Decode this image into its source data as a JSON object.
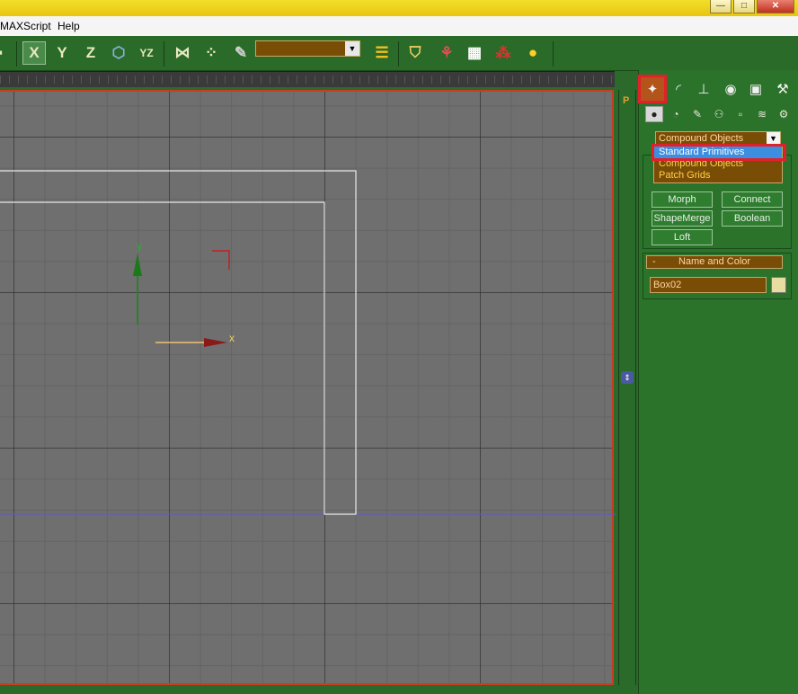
{
  "window": {
    "minimize": "—",
    "maximize": "□",
    "close": "✕"
  },
  "menu": {
    "items": [
      "MAXScript",
      "Help"
    ]
  },
  "toolbar": {
    "axis_x": "X",
    "axis_y": "Y",
    "axis_z": "Z",
    "plane": "YZ",
    "selection_set_value": ""
  },
  "viewport": {
    "axis_y_label": "y",
    "axis_x_label": "x",
    "grid_color": "#6f6f6f",
    "border_color": "#c83d22"
  },
  "sidebar_strip": {
    "label": "P"
  },
  "command_panel": {
    "category_value": "Compound Objects",
    "category_options": [
      "Standard Primitives",
      "Compound Objects",
      "Patch Grids"
    ],
    "highlighted_option": "Standard Primitives",
    "object_buttons": [
      "Morph",
      "Connect",
      "ShapeMerge",
      "Boolean",
      "Loft"
    ],
    "name_and_color": {
      "header": "Name and Color",
      "collapse_symbol": "-",
      "name_value": "Box02",
      "swatch_color": "#e8dca0"
    },
    "object_type_collapse": "-"
  },
  "colors": {
    "ui_green": "#2b722b",
    "field_brown": "#7a4d06",
    "highlight_red": "#e2202a",
    "selection_blue": "#3c8fe0"
  }
}
